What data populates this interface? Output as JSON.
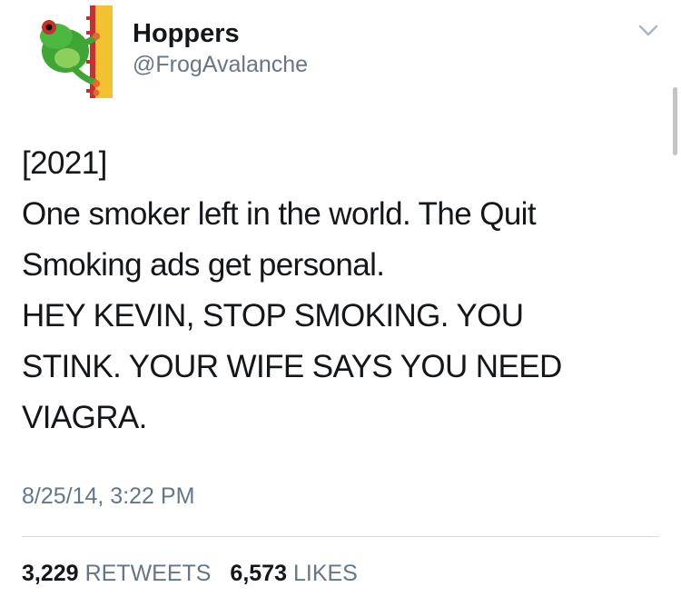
{
  "user": {
    "display_name": "Hoppers",
    "handle": "@FrogAvalanche"
  },
  "tweet": {
    "lines": [
      "[2021]",
      "One smoker left in the world. The Quit",
      "Smoking ads get personal.",
      "HEY KEVIN, STOP SMOKING. YOU",
      "STINK. YOUR WIFE SAYS YOU NEED",
      "VIAGRA."
    ],
    "timestamp": "8/25/14, 3:22 PM"
  },
  "stats": {
    "retweets_count": "3,229",
    "retweets_label": "RETWEETS",
    "likes_count": "6,573",
    "likes_label": "LIKES"
  },
  "icons": {
    "avatar": "frog-avatar",
    "menu": "chevron-down-icon"
  },
  "colors": {
    "text": "#14171a",
    "secondary": "#657786",
    "divider": "#dddddd"
  }
}
